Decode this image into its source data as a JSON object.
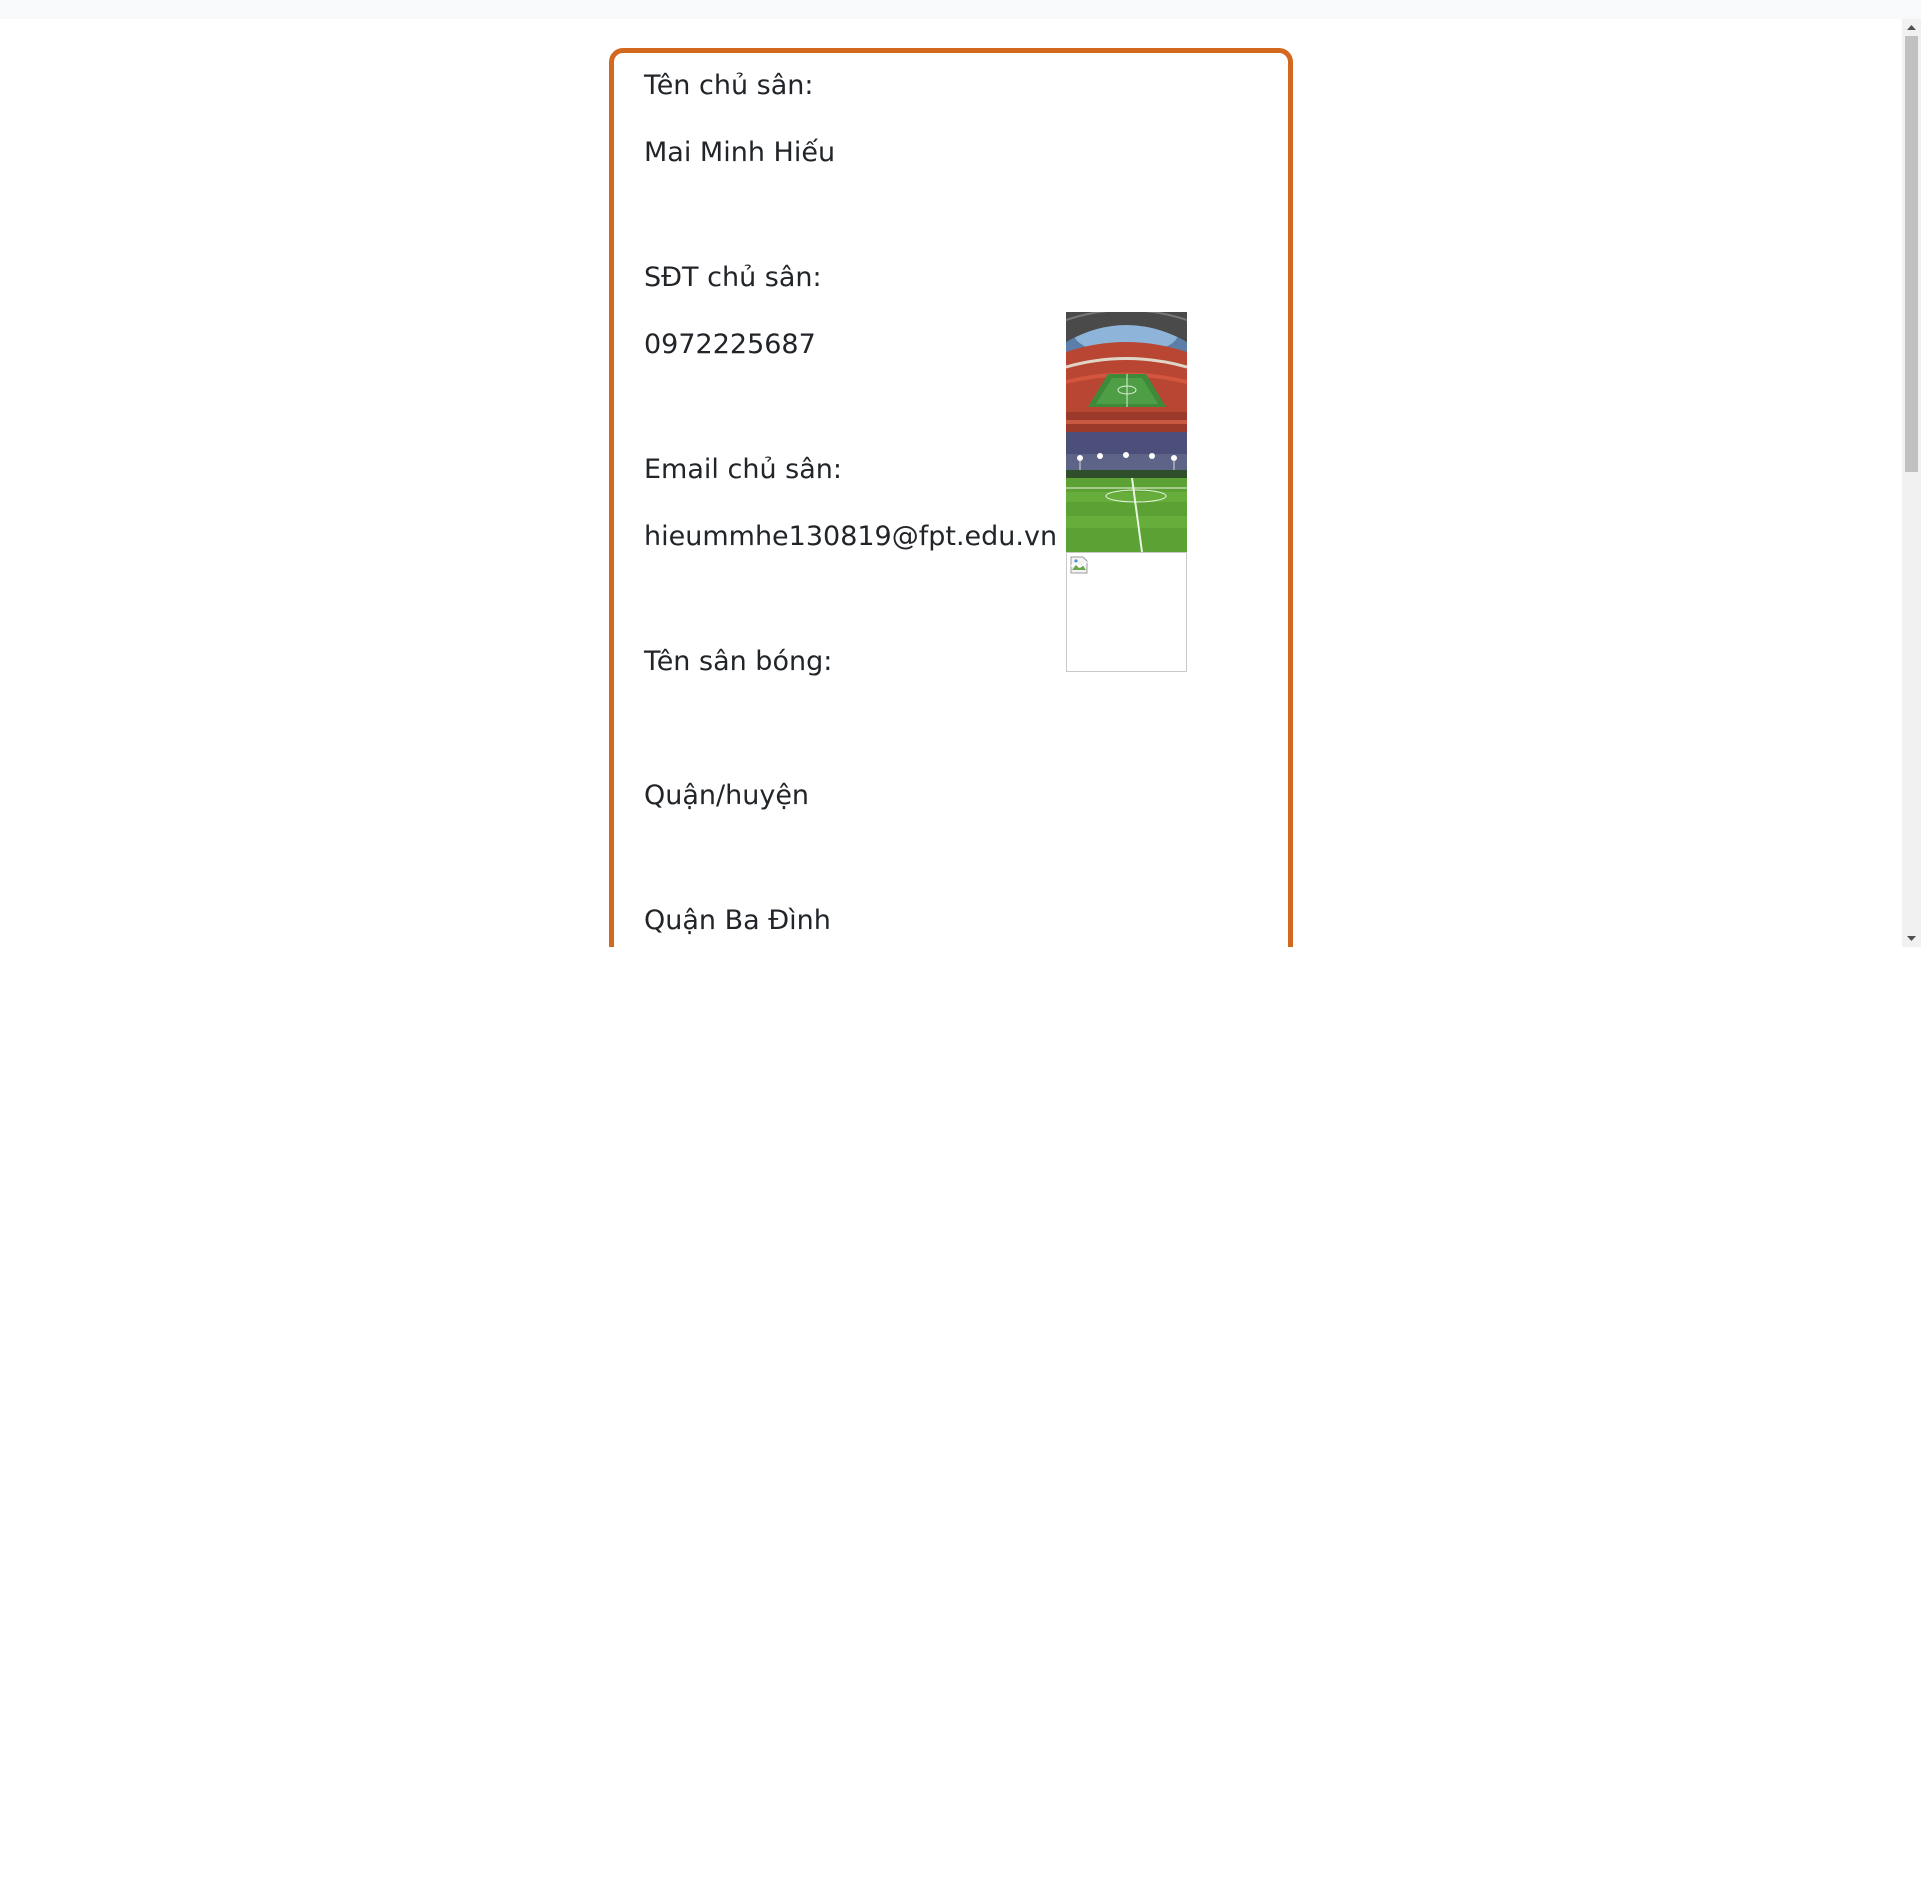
{
  "owner": {
    "name_label": "Tên chủ sân:",
    "name_value": "Mai Minh Hiếu",
    "phone_label": "SĐT chủ sân:",
    "phone_value": "0972225687",
    "email_label": "Email chủ sân:",
    "email_value": "hieummhe130819@fpt.edu.vn"
  },
  "field": {
    "name_label": "Tên sân bóng:",
    "name_value": "",
    "district_label": "Quận/huyện",
    "district_value": "Quận Ba Đình"
  },
  "gallery": {
    "images": [
      {
        "name": "stadium-photo"
      },
      {
        "name": "night-pitch-photo"
      },
      {
        "name": "broken-image-icon"
      }
    ]
  },
  "colors": {
    "card_border": "#d2691e",
    "text": "#212529",
    "page_background": "#ffffff",
    "top_strip": "#f8f9fa"
  }
}
